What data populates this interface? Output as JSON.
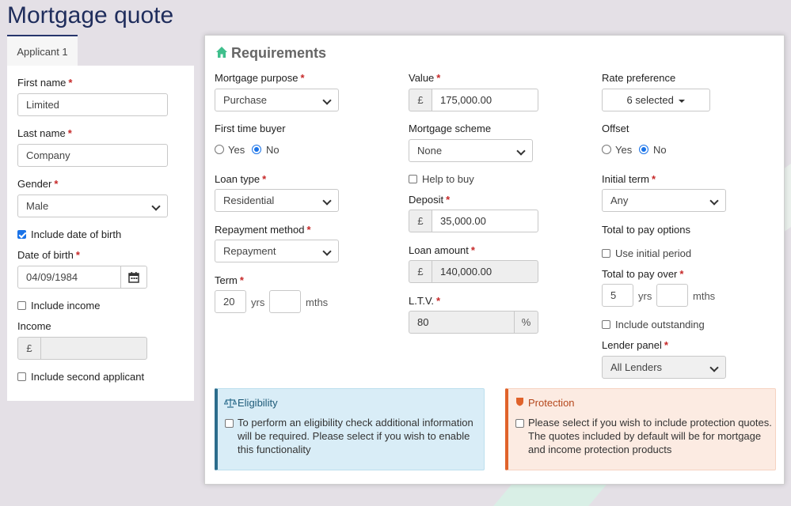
{
  "page": {
    "title": "Mortgage quote"
  },
  "tabs": [
    {
      "label": "Applicant 1"
    }
  ],
  "applicant": {
    "first_name": {
      "label": "First name",
      "required": "*",
      "value": "Limited"
    },
    "last_name": {
      "label": "Last name",
      "required": "*",
      "value": "Company"
    },
    "gender": {
      "label": "Gender",
      "required": "*",
      "value": "Male"
    },
    "include_dob": {
      "label": "Include date of birth",
      "checked": true
    },
    "dob": {
      "label": "Date of birth",
      "required": "*",
      "value": "04/09/1984",
      "icon": "calendar-icon"
    },
    "include_income": {
      "label": "Include income",
      "checked": false
    },
    "income": {
      "label": "Income",
      "currency": "£",
      "value": ""
    },
    "include_second": {
      "label": "Include second applicant",
      "checked": false
    }
  },
  "requirements": {
    "title": "Requirements",
    "icon": "home-icon",
    "mortgage_purpose": {
      "label": "Mortgage purpose",
      "required": "*",
      "value": "Purchase"
    },
    "first_time_buyer": {
      "label": "First time buyer",
      "yes": "Yes",
      "no": "No",
      "selected": "No"
    },
    "loan_type": {
      "label": "Loan type",
      "required": "*",
      "value": "Residential"
    },
    "repayment_method": {
      "label": "Repayment method",
      "required": "*",
      "value": "Repayment"
    },
    "term": {
      "label": "Term",
      "required": "*",
      "years": "20",
      "years_unit": "yrs",
      "months": "",
      "months_unit": "mths"
    },
    "value": {
      "label": "Value",
      "required": "*",
      "currency": "£",
      "amount": "175,000.00"
    },
    "mortgage_scheme": {
      "label": "Mortgage scheme",
      "value": "None"
    },
    "help_to_buy": {
      "label": "Help to buy",
      "checked": false
    },
    "deposit": {
      "label": "Deposit",
      "required": "*",
      "currency": "£",
      "amount": "35,000.00"
    },
    "loan_amount": {
      "label": "Loan amount",
      "required": "*",
      "currency": "£",
      "amount": "140,000.00"
    },
    "ltv": {
      "label": "L.T.V.",
      "required": "*",
      "value": "80",
      "unit": "%"
    },
    "rate_preference": {
      "label": "Rate preference",
      "value": "6 selected"
    },
    "offset": {
      "label": "Offset",
      "yes": "Yes",
      "no": "No",
      "selected": "No"
    },
    "initial_term": {
      "label": "Initial term",
      "required": "*",
      "value": "Any"
    },
    "total_to_pay_options": {
      "label": "Total to pay options"
    },
    "use_initial_period": {
      "label": "Use initial period",
      "checked": false
    },
    "total_to_pay_over": {
      "label": "Total to pay over",
      "required": "*",
      "years": "5",
      "years_unit": "yrs",
      "months": "",
      "months_unit": "mths"
    },
    "include_outstanding": {
      "label": "Include outstanding",
      "checked": false
    },
    "lender_panel": {
      "label": "Lender panel",
      "required": "*",
      "value": "All Lenders"
    }
  },
  "eligibility": {
    "title": "Eligibility",
    "icon": "scales-icon",
    "text": "To perform an eligibility check additional information will be required. Please select if you wish to enable this functionality",
    "color": "#2b6c8c"
  },
  "protection": {
    "title": "Protection",
    "icon": "shield-icon",
    "text": "Please select if you wish to include protection quotes. The quotes included by default will be for mortgage and income protection products",
    "color": "#e0622a"
  }
}
